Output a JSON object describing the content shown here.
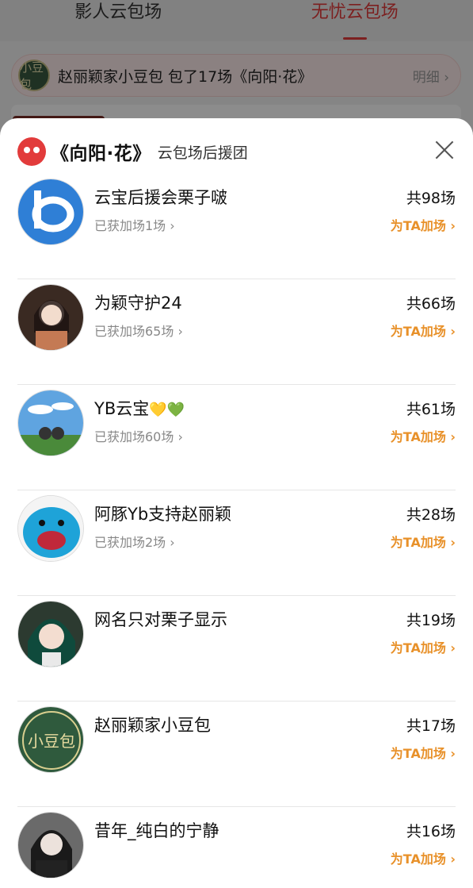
{
  "tabs": [
    {
      "label": "影人云包场",
      "active": false
    },
    {
      "label": "无忧云包场",
      "active": true
    }
  ],
  "banner": {
    "avatar_text": "小豆包",
    "text": "赵丽颖家小豆包 包了17场《向阳·花》",
    "more": "明细 ›"
  },
  "sheet": {
    "title": "《向阳·花》",
    "subtitle": "云包场后援团",
    "close_icon": "close-icon"
  },
  "rows": [
    {
      "name": "云宝后援会栗子啵",
      "sub": "已获加场1场 ›",
      "total": "共98场",
      "boost": "为TA加场 ›"
    },
    {
      "name": "为颖守护24",
      "sub": "已获加场65场 ›",
      "total": "共66场",
      "boost": "为TA加场 ›"
    },
    {
      "name": "YB云宝",
      "hearts": "💛💚",
      "sub": "已获加场60场 ›",
      "total": "共61场",
      "boost": "为TA加场 ›"
    },
    {
      "name": "阿豚Yb支持赵丽颖",
      "sub": "已获加场2场 ›",
      "total": "共28场",
      "boost": "为TA加场 ›"
    },
    {
      "name": "网名只对栗子显示",
      "sub": "",
      "total": "共19场",
      "boost": "为TA加场 ›"
    },
    {
      "name": "赵丽颖家小豆包",
      "sub": "",
      "total": "共17场",
      "boost": "为TA加场 ›"
    },
    {
      "name": "昔年_纯白的宁静",
      "sub": "",
      "total": "共16场",
      "boost": "为TA加场 ›"
    }
  ],
  "colors": {
    "accent": "#e23b3b",
    "boost": "#e8912a"
  }
}
